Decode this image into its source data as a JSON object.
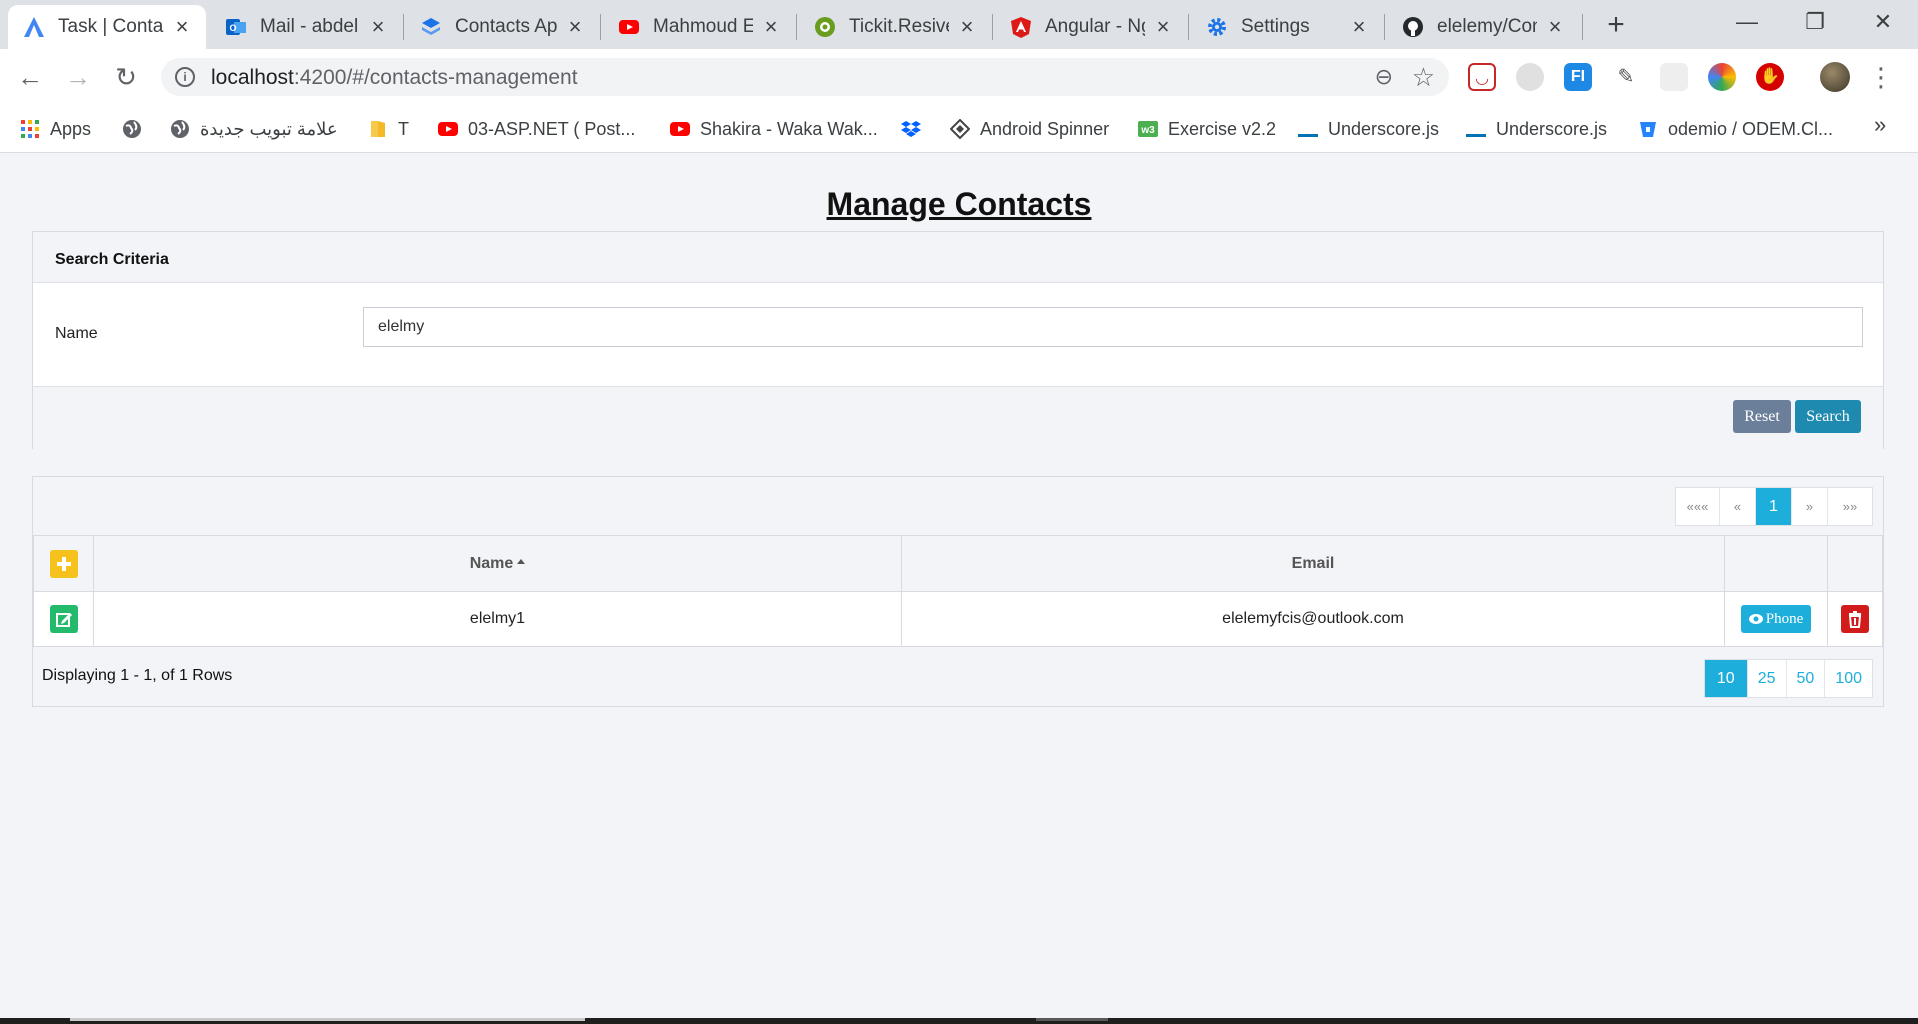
{
  "browser": {
    "tabs": [
      {
        "title": "Task | Contac",
        "icon": "angular-blue-icon",
        "active": true
      },
      {
        "title": "Mail - abdel",
        "icon": "outlook-icon"
      },
      {
        "title": "Contacts Ap",
        "icon": "stack-icon"
      },
      {
        "title": "Mahmoud El",
        "icon": "youtube-icon"
      },
      {
        "title": "Tickit.Resive",
        "icon": "tickit-icon"
      },
      {
        "title": "Angular - Ng",
        "icon": "angular-red-icon"
      },
      {
        "title": "Settings",
        "icon": "gear-icon"
      },
      {
        "title": "elelemy/Con",
        "icon": "github-icon"
      }
    ],
    "url_host": "localhost",
    "url_rest": ":4200/#/contacts-management",
    "bookmarks": [
      {
        "label": "Apps",
        "icon": "apps-grid-icon"
      },
      {
        "label": "",
        "icon": "globe-icon"
      },
      {
        "label": "علامة تبويب جديدة",
        "icon": "globe-icon"
      },
      {
        "label": "T",
        "icon": "folder-icon"
      },
      {
        "label": "03-ASP.NET ( Post...",
        "icon": "youtube-icon"
      },
      {
        "label": "Shakira - Waka Wak...",
        "icon": "youtube-icon"
      },
      {
        "label": "",
        "icon": "dropbox-icon"
      },
      {
        "label": "Android Spinner",
        "icon": "diamond-icon"
      },
      {
        "label": "Exercise v2.2",
        "icon": "w3-icon"
      },
      {
        "label": "Underscore.js",
        "icon": "underscore-icon"
      },
      {
        "label": "Underscore.js",
        "icon": "underscore-icon"
      },
      {
        "label": "odemio / ODEM.Cl...",
        "icon": "bitbucket-icon"
      }
    ],
    "bookmarks_more": "»"
  },
  "page": {
    "title": "Manage Contacts",
    "search": {
      "header": "Search Criteria",
      "name_label": "Name",
      "name_value": "elelmy",
      "reset_label": "Reset",
      "search_label": "Search"
    },
    "grid": {
      "pager": [
        "«««",
        "«",
        "1",
        "»",
        "»»"
      ],
      "columns": {
        "name": "Name",
        "email": "Email"
      },
      "rows": [
        {
          "name": "elelmy1",
          "email": "elelemyfcis@outlook.com",
          "phone_label": "Phone"
        }
      ],
      "footer_text": "Displaying 1 - 1, of 1 Rows",
      "page_sizes": [
        "10",
        "25",
        "50",
        "100"
      ],
      "selected_page_size": "10"
    }
  },
  "colors": {
    "accent": "#1eaedb",
    "reset": "#6b7f9b",
    "search": "#1f8ab0",
    "add": "#f4c11d",
    "edit": "#23ba6b",
    "delete": "#d21c1c"
  }
}
